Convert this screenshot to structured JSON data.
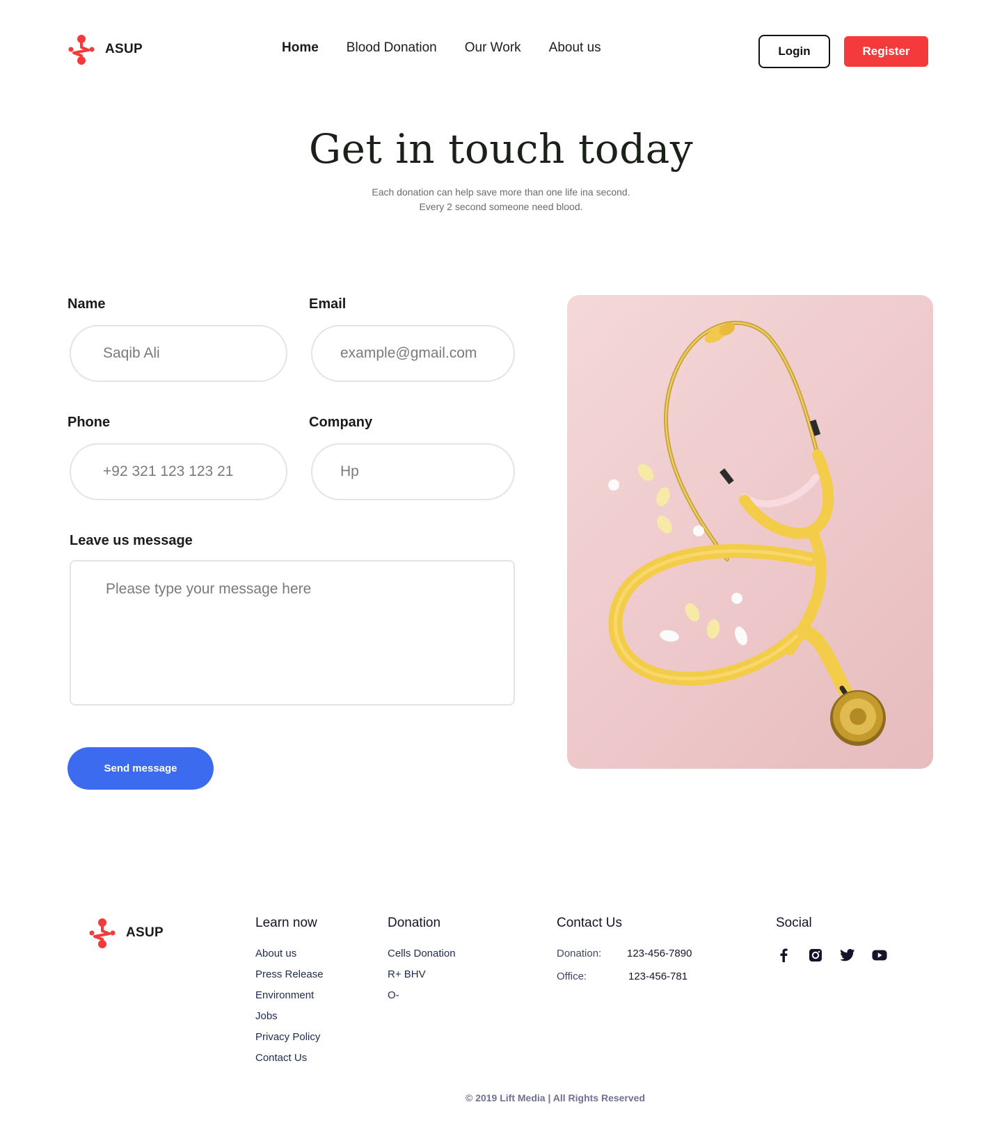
{
  "header": {
    "brand": "ASUP",
    "nav": [
      "Home",
      "Blood Donation",
      "Our Work",
      "About us"
    ],
    "login_label": "Login",
    "register_label": "Register"
  },
  "hero": {
    "title": "Get in touch today",
    "subtitle_line1": "Each donation can help save more than one life ina second.",
    "subtitle_line2": "Every 2 second someone need blood."
  },
  "form": {
    "name_label": "Name",
    "name_value": "Saqib Ali",
    "email_label": "Email",
    "email_placeholder": "example@gmail.com",
    "phone_label": "Phone",
    "phone_value": "+92 321 123 123 21",
    "company_label": "Company",
    "company_value": "Hp",
    "message_label": "Leave us message",
    "message_placeholder": "Please type your message here",
    "send_label": "Send message"
  },
  "footer": {
    "brand": "ASUP",
    "learn": {
      "title": "Learn now",
      "items": [
        "About us",
        "Press Release",
        "Environment",
        "Jobs",
        "Privacy Policy",
        "Contact Us"
      ]
    },
    "donation": {
      "title": "Donation",
      "items": [
        "Cells Donation",
        "R+ BHV",
        "O-"
      ]
    },
    "contact": {
      "title": "Contact Us",
      "donation_key": "Donation:",
      "donation_value": "123-456-7890",
      "office_key": "Office:",
      "office_value": "123-456-781"
    },
    "social": {
      "title": "Social",
      "icons": [
        "facebook-icon",
        "instagram-icon",
        "twitter-icon",
        "youtube-icon"
      ]
    },
    "copyright": "© 2019 Lift Media | All Rights Reserved"
  },
  "colors": {
    "accent_red": "#f43a3a",
    "button_blue": "#3d6bf0",
    "photo_pink": "#efcbcd",
    "stethoscope_yellow": "#f3cc4a"
  }
}
